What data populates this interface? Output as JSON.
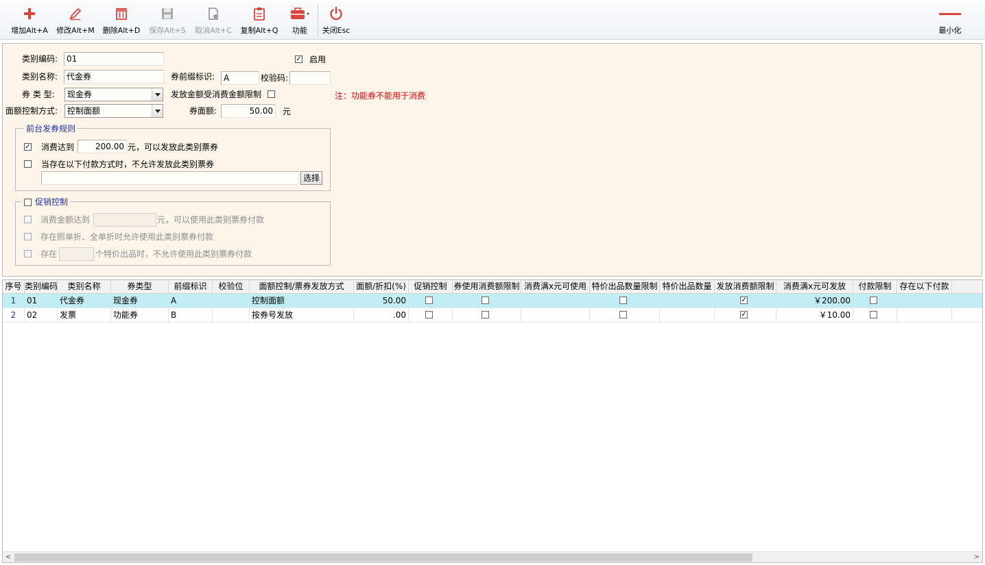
{
  "toolbar": {
    "add": "增加Alt+A",
    "edit": "修改Alt+M",
    "delete": "删除Alt+D",
    "save": "保存Alt+S",
    "cancel": "取消Alt+C",
    "copy": "复制Alt+Q",
    "func": "功能",
    "close": "关闭Esc",
    "minimize": "最小化"
  },
  "colors": {
    "accent": "#d9453c",
    "selection": "#c1edf5",
    "panel": "#fdf4ea",
    "group_title": "#1b33a8",
    "note": "#e00000"
  },
  "form": {
    "code_label": "类别编码:",
    "code_value": "01",
    "enabled_label": "启用",
    "enabled_checked": "✓",
    "name_label": "类别名称:",
    "name_value": "代金券",
    "prefix_label": "券前缀标识:",
    "prefix_value": "A",
    "check_label": "校验码:",
    "check_value": "",
    "type_label": "券 类 型:",
    "type_value": "现金券",
    "limit_label": "发放金额受消费金额限制",
    "note": "注：功能券不能用于消费",
    "face_mode_label": "面额控制方式:",
    "face_mode_value": "控制面额",
    "face_value_label": "券面额:",
    "face_value": "50.00",
    "face_unit": "元"
  },
  "rules": {
    "title": "前台发券规则",
    "reach_label": "消费达到",
    "reach_checked": "✓",
    "reach_value": "200.00",
    "reach_suffix": "元，可以发放此类别票券",
    "pay_label": "当存在以下付款方式时，不允许发放此类别票券",
    "pay_value": "",
    "select_button": "选择"
  },
  "promo": {
    "title": "促销控制",
    "amount_label": "消费金额达到",
    "amount_value": "",
    "amount_suffix": "元，可以使用此类别票券付款",
    "discount_label": "存在照单折、全单折时允许使用此类别票券付款",
    "special_prefix": "存在",
    "special_value": "",
    "special_suffix": "个特价出品时，不允许使用此类别票券付款"
  },
  "grid": {
    "headers": [
      "序号",
      "类别编码",
      "类别名称",
      "券类型",
      "前缀标识",
      "校验位",
      "面额控制/票券发放方式",
      "面额/折扣(%)",
      "促销控制",
      "券使用消费额限制",
      "消费满x元可使用",
      "特价出品数量限制",
      "特价出品数量",
      "发放消费额限制",
      "消费满x元可发放",
      "付款限制",
      "存在以下付款"
    ],
    "rows": [
      {
        "idx": "1",
        "code": "01",
        "name": "代金券",
        "type": "现金券",
        "prefix": "A",
        "check": "",
        "mode": "控制面额",
        "amount": "50.00",
        "promo": "",
        "use_limit": "",
        "use_min": "",
        "special_limit": "",
        "special_qty": "",
        "issue_limit": "✓",
        "issue_min": "￥200.00",
        "pay_limit": "",
        "pay_methods": ""
      },
      {
        "idx": "2",
        "code": "02",
        "name": "发票",
        "type": "功能券",
        "prefix": "B",
        "check": "",
        "mode": "按券号发放",
        "amount": ".00",
        "promo": "",
        "use_limit": "",
        "use_min": "",
        "special_limit": "",
        "special_qty": "",
        "issue_limit": "✓",
        "issue_min": "￥10.00",
        "pay_limit": "",
        "pay_methods": ""
      }
    ]
  }
}
